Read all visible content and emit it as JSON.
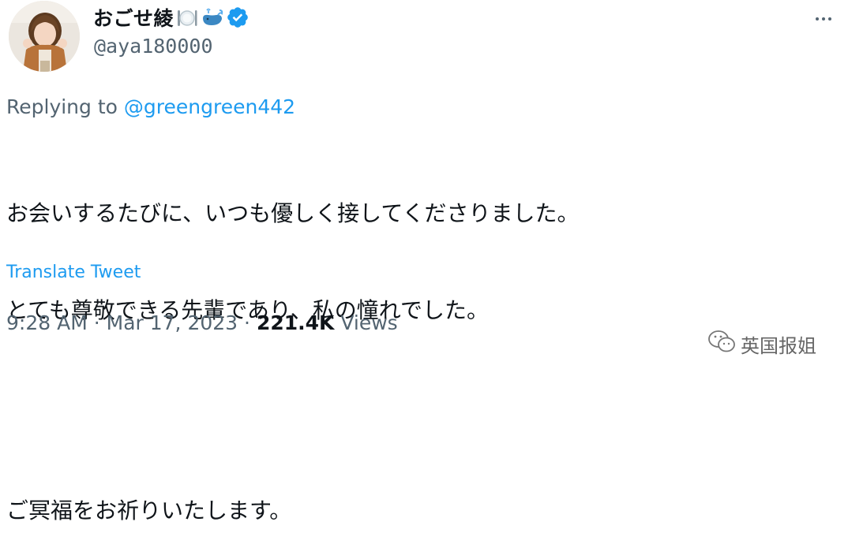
{
  "author": {
    "display_name": "おごせ綾",
    "handle": "@aya180000",
    "verified": true,
    "emoji_icons": [
      "fork-knife-plate-icon",
      "whale-icon"
    ]
  },
  "reply": {
    "prefix": "Replying to",
    "mention": "@greengreen442"
  },
  "tweet": {
    "lines": [
      "お会いするたびに、いつも優しく接してくださりました。",
      "とても尊敬できる先輩であり、私の憧れでした。",
      "ご冥福をお祈りいたします。"
    ],
    "translate_label": "Translate Tweet"
  },
  "meta": {
    "time": "9:28 AM",
    "separator": "·",
    "date": "Mar 17, 2023",
    "views_count": "221.4K",
    "views_label": "Views"
  },
  "watermark": {
    "text": "英国报姐"
  },
  "colors": {
    "accent": "#1d9bf0",
    "secondary_text": "#536471",
    "primary_text": "#0f1419"
  }
}
